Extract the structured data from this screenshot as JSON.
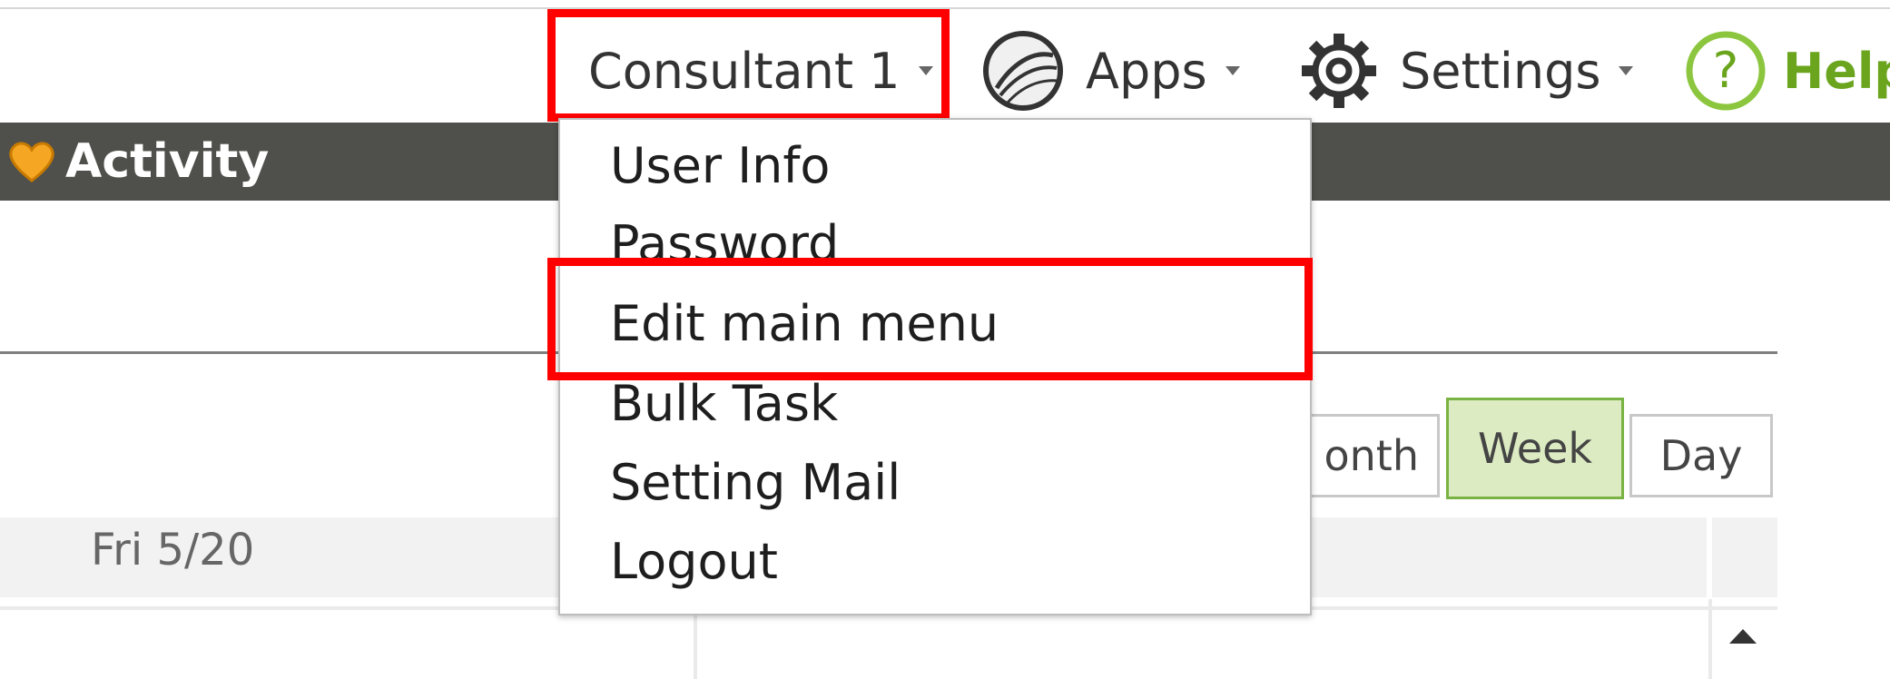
{
  "topbar": {
    "user_label": "Consultant 1",
    "apps_label": "Apps",
    "settings_label": "Settings",
    "help_label": "Help"
  },
  "nav": {
    "activity_label": "Activity"
  },
  "user_menu": {
    "items": [
      "User Info",
      "Password",
      "Edit main menu",
      "Bulk Task",
      "Setting Mail",
      "Logout"
    ]
  },
  "calendar": {
    "view_buttons": [
      "onth",
      "Week",
      "Day"
    ],
    "active_view": "Week",
    "day_header": "Fri 5/20"
  },
  "colors": {
    "highlight": "#ff0000",
    "nav_band": "#4f4f4b",
    "active_view_bg": "#dcebc2",
    "active_view_border": "#79b343",
    "help_green": "#6aa51d",
    "activity_icon": "#f5a623"
  },
  "icons": {
    "apps": "globe-icon",
    "settings": "gear-icon",
    "help": "question-circle-icon",
    "activity": "heart-icon",
    "scroll_up": "triangle-up-icon"
  }
}
